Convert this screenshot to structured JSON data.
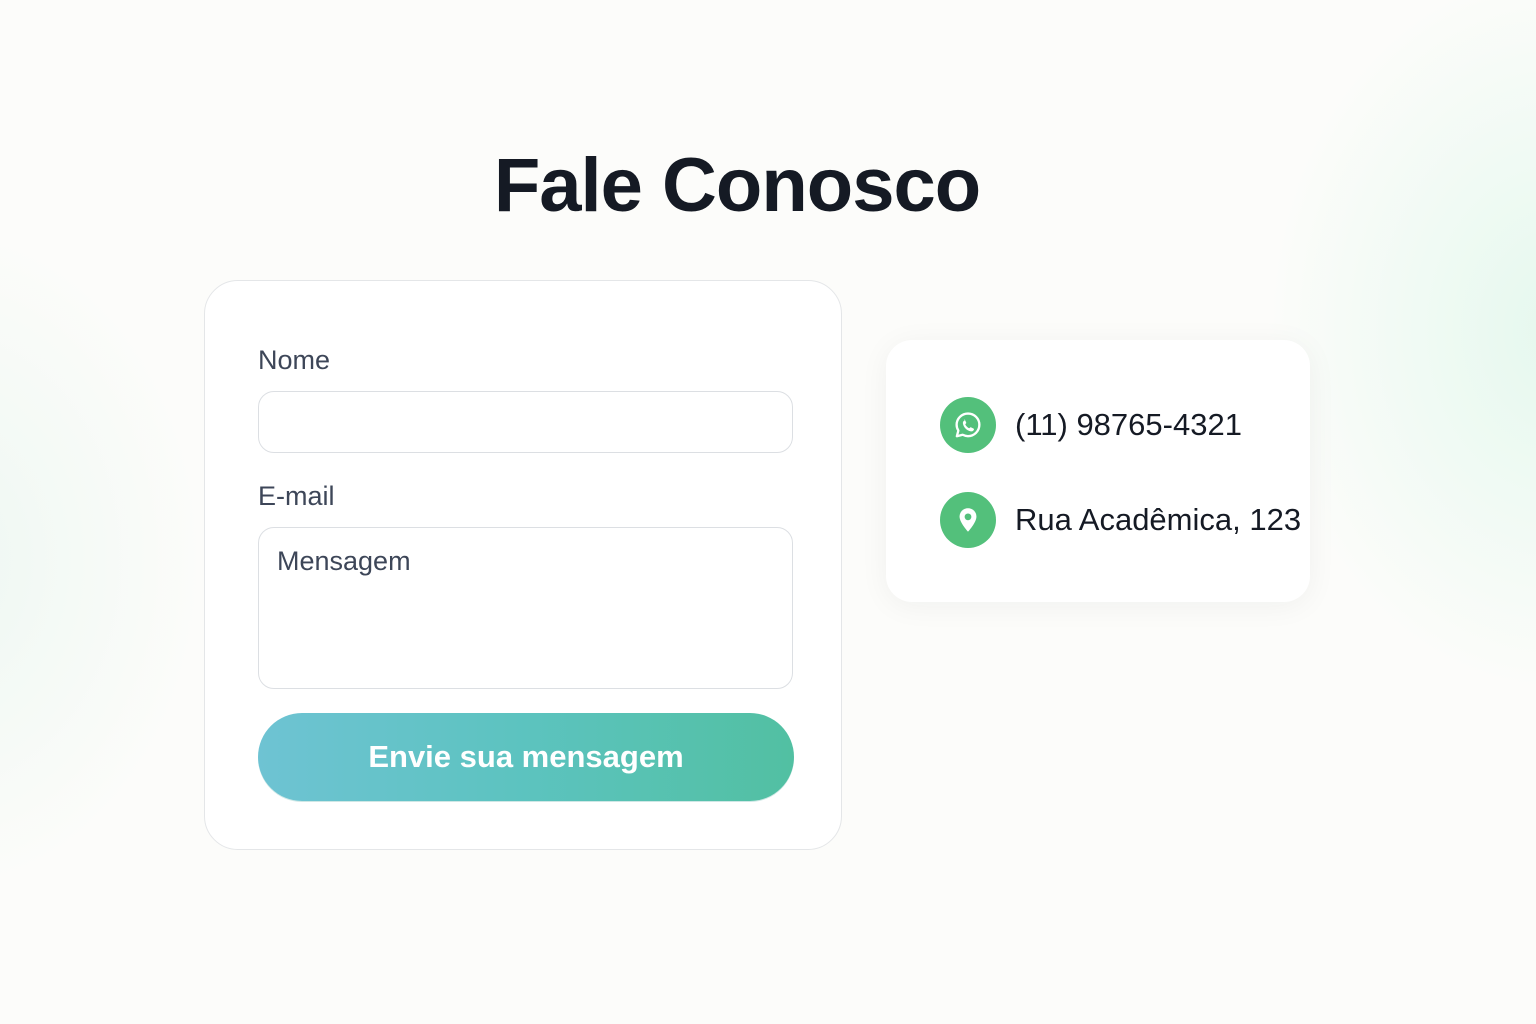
{
  "header": {
    "title": "Fale Conosco"
  },
  "form": {
    "name_label": "Nome",
    "name_value": "",
    "email_label": "E-mail",
    "message_placeholder": "Mensagem",
    "message_value": "",
    "submit_label": "Envie sua mensagem"
  },
  "contact": {
    "phone": "(11) 98765-4321",
    "phone_icon": "whatsapp-icon",
    "address": "Rua Acadêmica, 123",
    "address_icon": "map-pin-icon"
  },
  "colors": {
    "accent_green": "#53c07b",
    "button_gradient_start": "#6ec3d3",
    "button_gradient_end": "#52c0a2",
    "title_text": "#151a24",
    "label_text": "#3d4658"
  }
}
